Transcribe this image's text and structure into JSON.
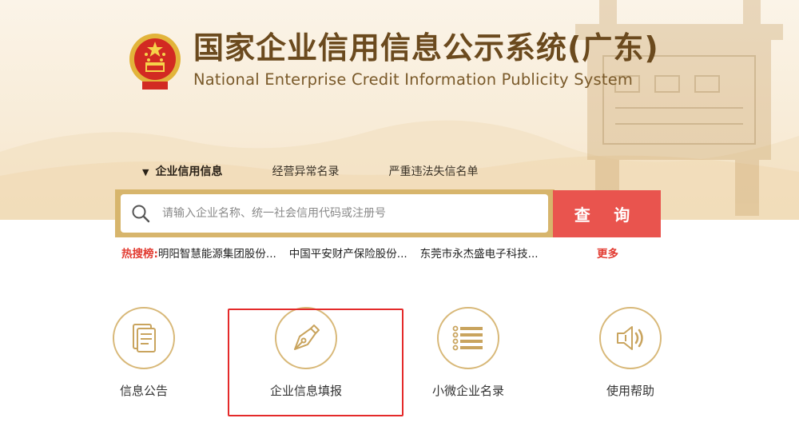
{
  "header": {
    "title_cn": "国家企业信用信息公示系统(广东)",
    "title_en": "National Enterprise Credit Information Publicity System",
    "emblem_icon": "national-emblem"
  },
  "tabs": [
    {
      "label": "企业信用信息",
      "active": true
    },
    {
      "label": "经营异常名录",
      "active": false
    },
    {
      "label": "严重违法失信名单",
      "active": false
    }
  ],
  "search": {
    "placeholder": "请输入企业名称、统一社会信用代码或注册号",
    "value": "",
    "button_label": "查 询"
  },
  "hot_search": {
    "label": "热搜榜:",
    "items": [
      "明阳智慧能源集团股份...",
      "中国平安财产保险股份...",
      "东莞市永杰盛电子科技..."
    ],
    "more_label": "更多"
  },
  "functions": [
    {
      "label": "信息公告",
      "icon": "document-icon"
    },
    {
      "label": "企业信息填报",
      "icon": "pen-nib-icon"
    },
    {
      "label": "小微企业名录",
      "icon": "list-icon"
    },
    {
      "label": "使用帮助",
      "icon": "speaker-icon"
    }
  ],
  "colors": {
    "accent_gold": "#d7b56c",
    "search_button": "#e9544e",
    "hot_red": "#e23c32",
    "highlight_border": "#e42a2a"
  }
}
